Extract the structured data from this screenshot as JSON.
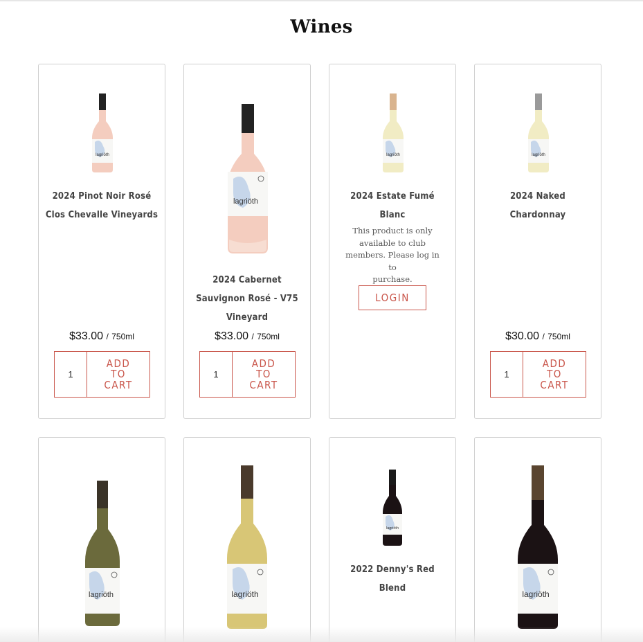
{
  "page": {
    "title": "Wines"
  },
  "products": [
    {
      "name_line1": "2024 Pinot Noir Rosé",
      "name_line2": "Clos Chevalle Vineyards",
      "price": "$33.00",
      "price_sep": "/",
      "size": "750ml",
      "quantity": "1",
      "add_to_cart": [
        "ADD",
        "TO",
        "CART"
      ],
      "bottle_label": "lagriöth"
    },
    {
      "name_line1": "2024 Cabernet",
      "name_line2": "Sauvignon Rosé - V75",
      "name_line3": "Vineyard",
      "price": "$33.00",
      "price_sep": "/",
      "size": "750ml",
      "quantity": "1",
      "add_to_cart": [
        "ADD",
        "TO",
        "CART"
      ],
      "bottle_label": "lagriöth"
    },
    {
      "name_line1": "2024 Estate Fumé",
      "name_line2": "Blanc",
      "note": [
        "This product is only",
        "available to club",
        "members. Please log in to",
        "purchase."
      ],
      "login_label": "LOGIN",
      "bottle_label": "lagriöth"
    },
    {
      "name_line1": "2024 Naked",
      "name_line2": "Chardonnay",
      "price": "$30.00",
      "price_sep": "/",
      "size": "750ml",
      "quantity": "1",
      "add_to_cart": [
        "ADD",
        "TO",
        "CART"
      ],
      "bottle_label": "lagriöth"
    },
    {
      "bottle_label": "lagriöth"
    },
    {
      "bottle_label": "lagriöth"
    },
    {
      "name_line1": "2022 Denny's Red",
      "name_line2": "Blend",
      "bottle_label": "lagriöth"
    },
    {
      "bottle_label": "lagriöth"
    }
  ],
  "colors": {
    "accent": "#c9554a",
    "border": "#cfcfcf",
    "rose": "#f4cdbf",
    "white_wine": "#f1ecc4",
    "gold_wine": "#d8c676",
    "olive_wine": "#6b6a3c",
    "red_wine": "#1b1214"
  },
  "icons": [
    "wine-bottle-image"
  ]
}
